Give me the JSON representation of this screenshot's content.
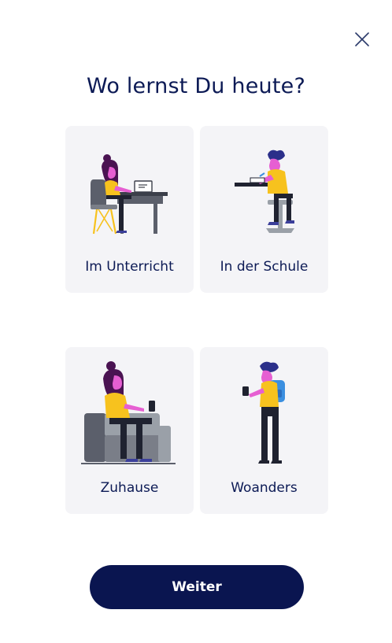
{
  "header": {
    "close_icon": "close-icon",
    "title": "Wo lernst Du heute?"
  },
  "options": [
    {
      "label": "Im Unterricht",
      "icon": "student-at-desk-illustration"
    },
    {
      "label": "In der Schule",
      "icon": "student-on-stool-illustration"
    },
    {
      "label": "Zuhause",
      "icon": "student-on-sofa-illustration"
    },
    {
      "label": "Woanders",
      "icon": "student-with-backpack-illustration"
    }
  ],
  "footer": {
    "continue_label": "Weiter"
  },
  "colors": {
    "primary": "#0a1550",
    "title_text": "#0c1a55",
    "card_bg": "#f4f4f7",
    "accent_yellow": "#f7c21e",
    "accent_pink": "#e65fd2",
    "accent_purple": "#4a1352"
  }
}
